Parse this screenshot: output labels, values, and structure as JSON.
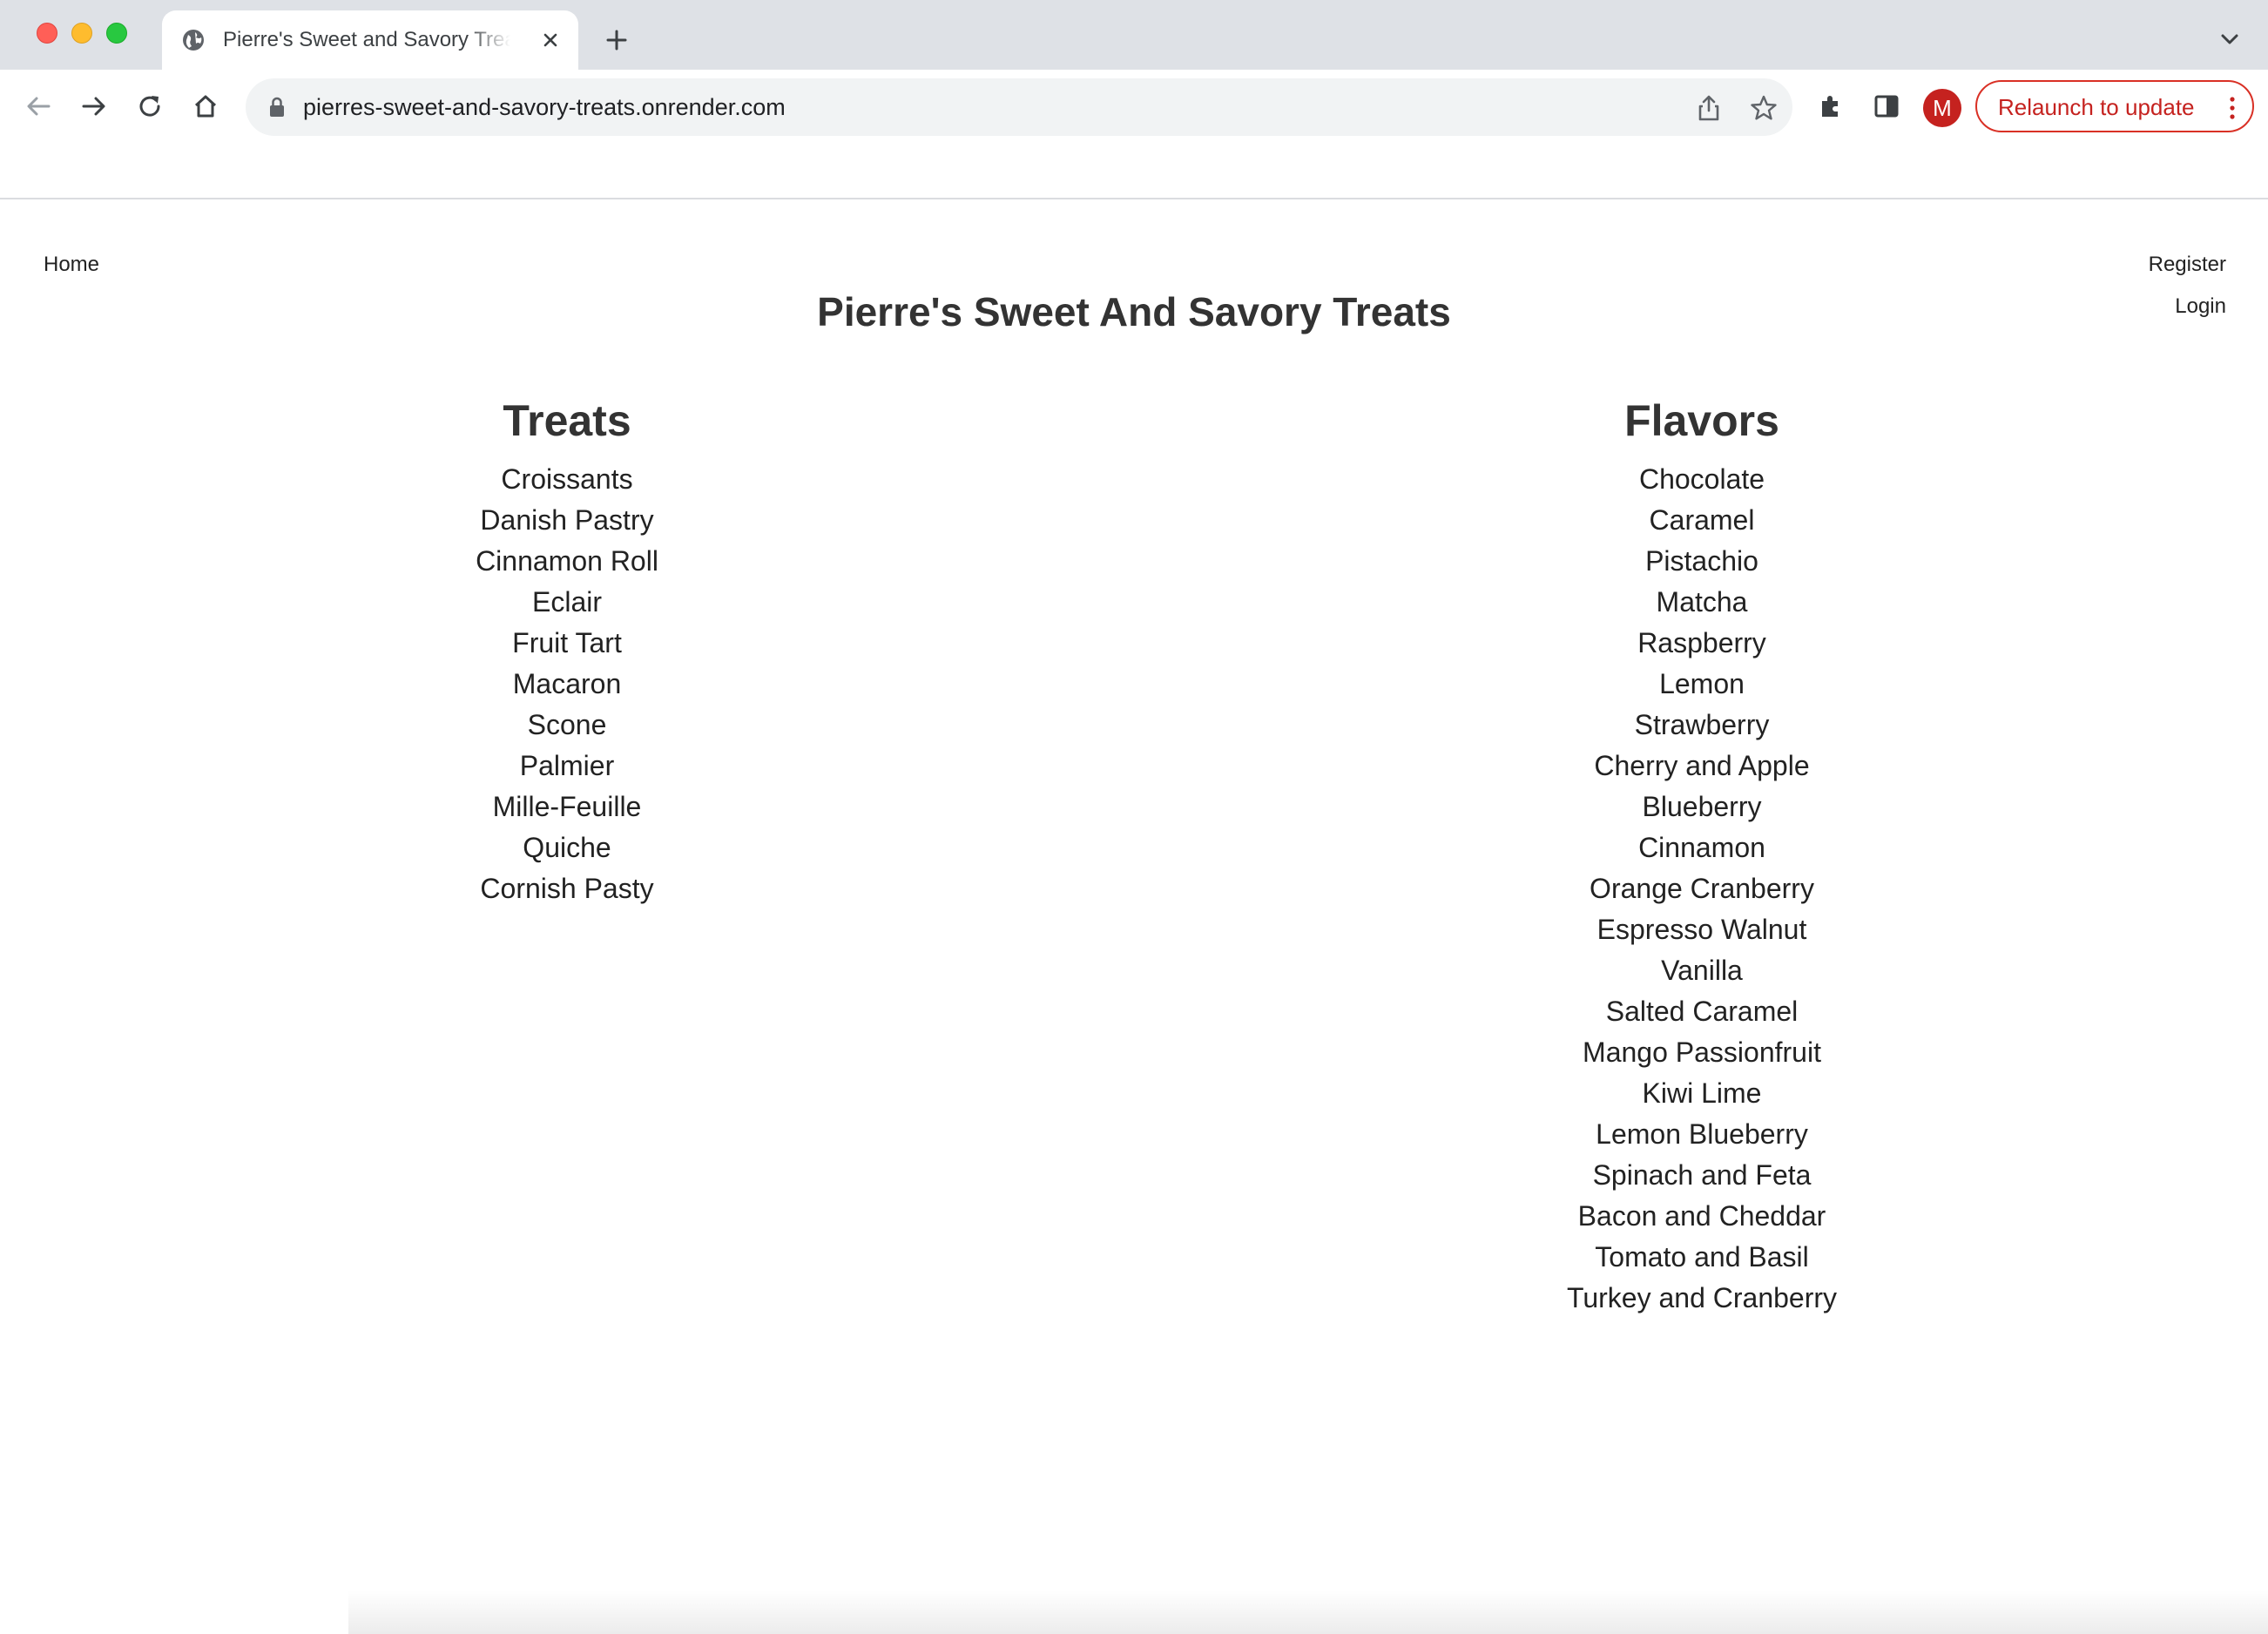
{
  "browser": {
    "tab_title": "Pierre's Sweet and Savory Treats",
    "url": "pierres-sweet-and-savory-treats.onrender.com",
    "avatar_letter": "M",
    "relaunch_label": "Relaunch to update"
  },
  "nav": {
    "home": "Home",
    "register": "Register",
    "login": "Login"
  },
  "site_title": "Pierre's Sweet And Savory Treats",
  "treats": {
    "heading": "Treats",
    "items": [
      "Croissants",
      "Danish Pastry",
      "Cinnamon Roll",
      "Eclair",
      "Fruit Tart",
      "Macaron",
      "Scone",
      "Palmier",
      "Mille-Feuille",
      "Quiche",
      "Cornish Pasty"
    ]
  },
  "flavors": {
    "heading": "Flavors",
    "items": [
      "Chocolate",
      "Caramel",
      "Pistachio",
      "Matcha",
      "Raspberry",
      "Lemon",
      "Strawberry",
      "Cherry and Apple",
      "Blueberry",
      "Cinnamon",
      "Orange Cranberry",
      "Espresso Walnut",
      "Vanilla",
      "Salted Caramel",
      "Mango Passionfruit",
      "Kiwi Lime",
      "Lemon Blueberry",
      "Spinach and Feta",
      "Bacon and Cheddar",
      "Tomato and Basil",
      "Turkey and Cranberry"
    ]
  },
  "colors": {
    "tabstrip": "#dee1e6",
    "accent_red": "#c5221f",
    "text": "#333333"
  }
}
